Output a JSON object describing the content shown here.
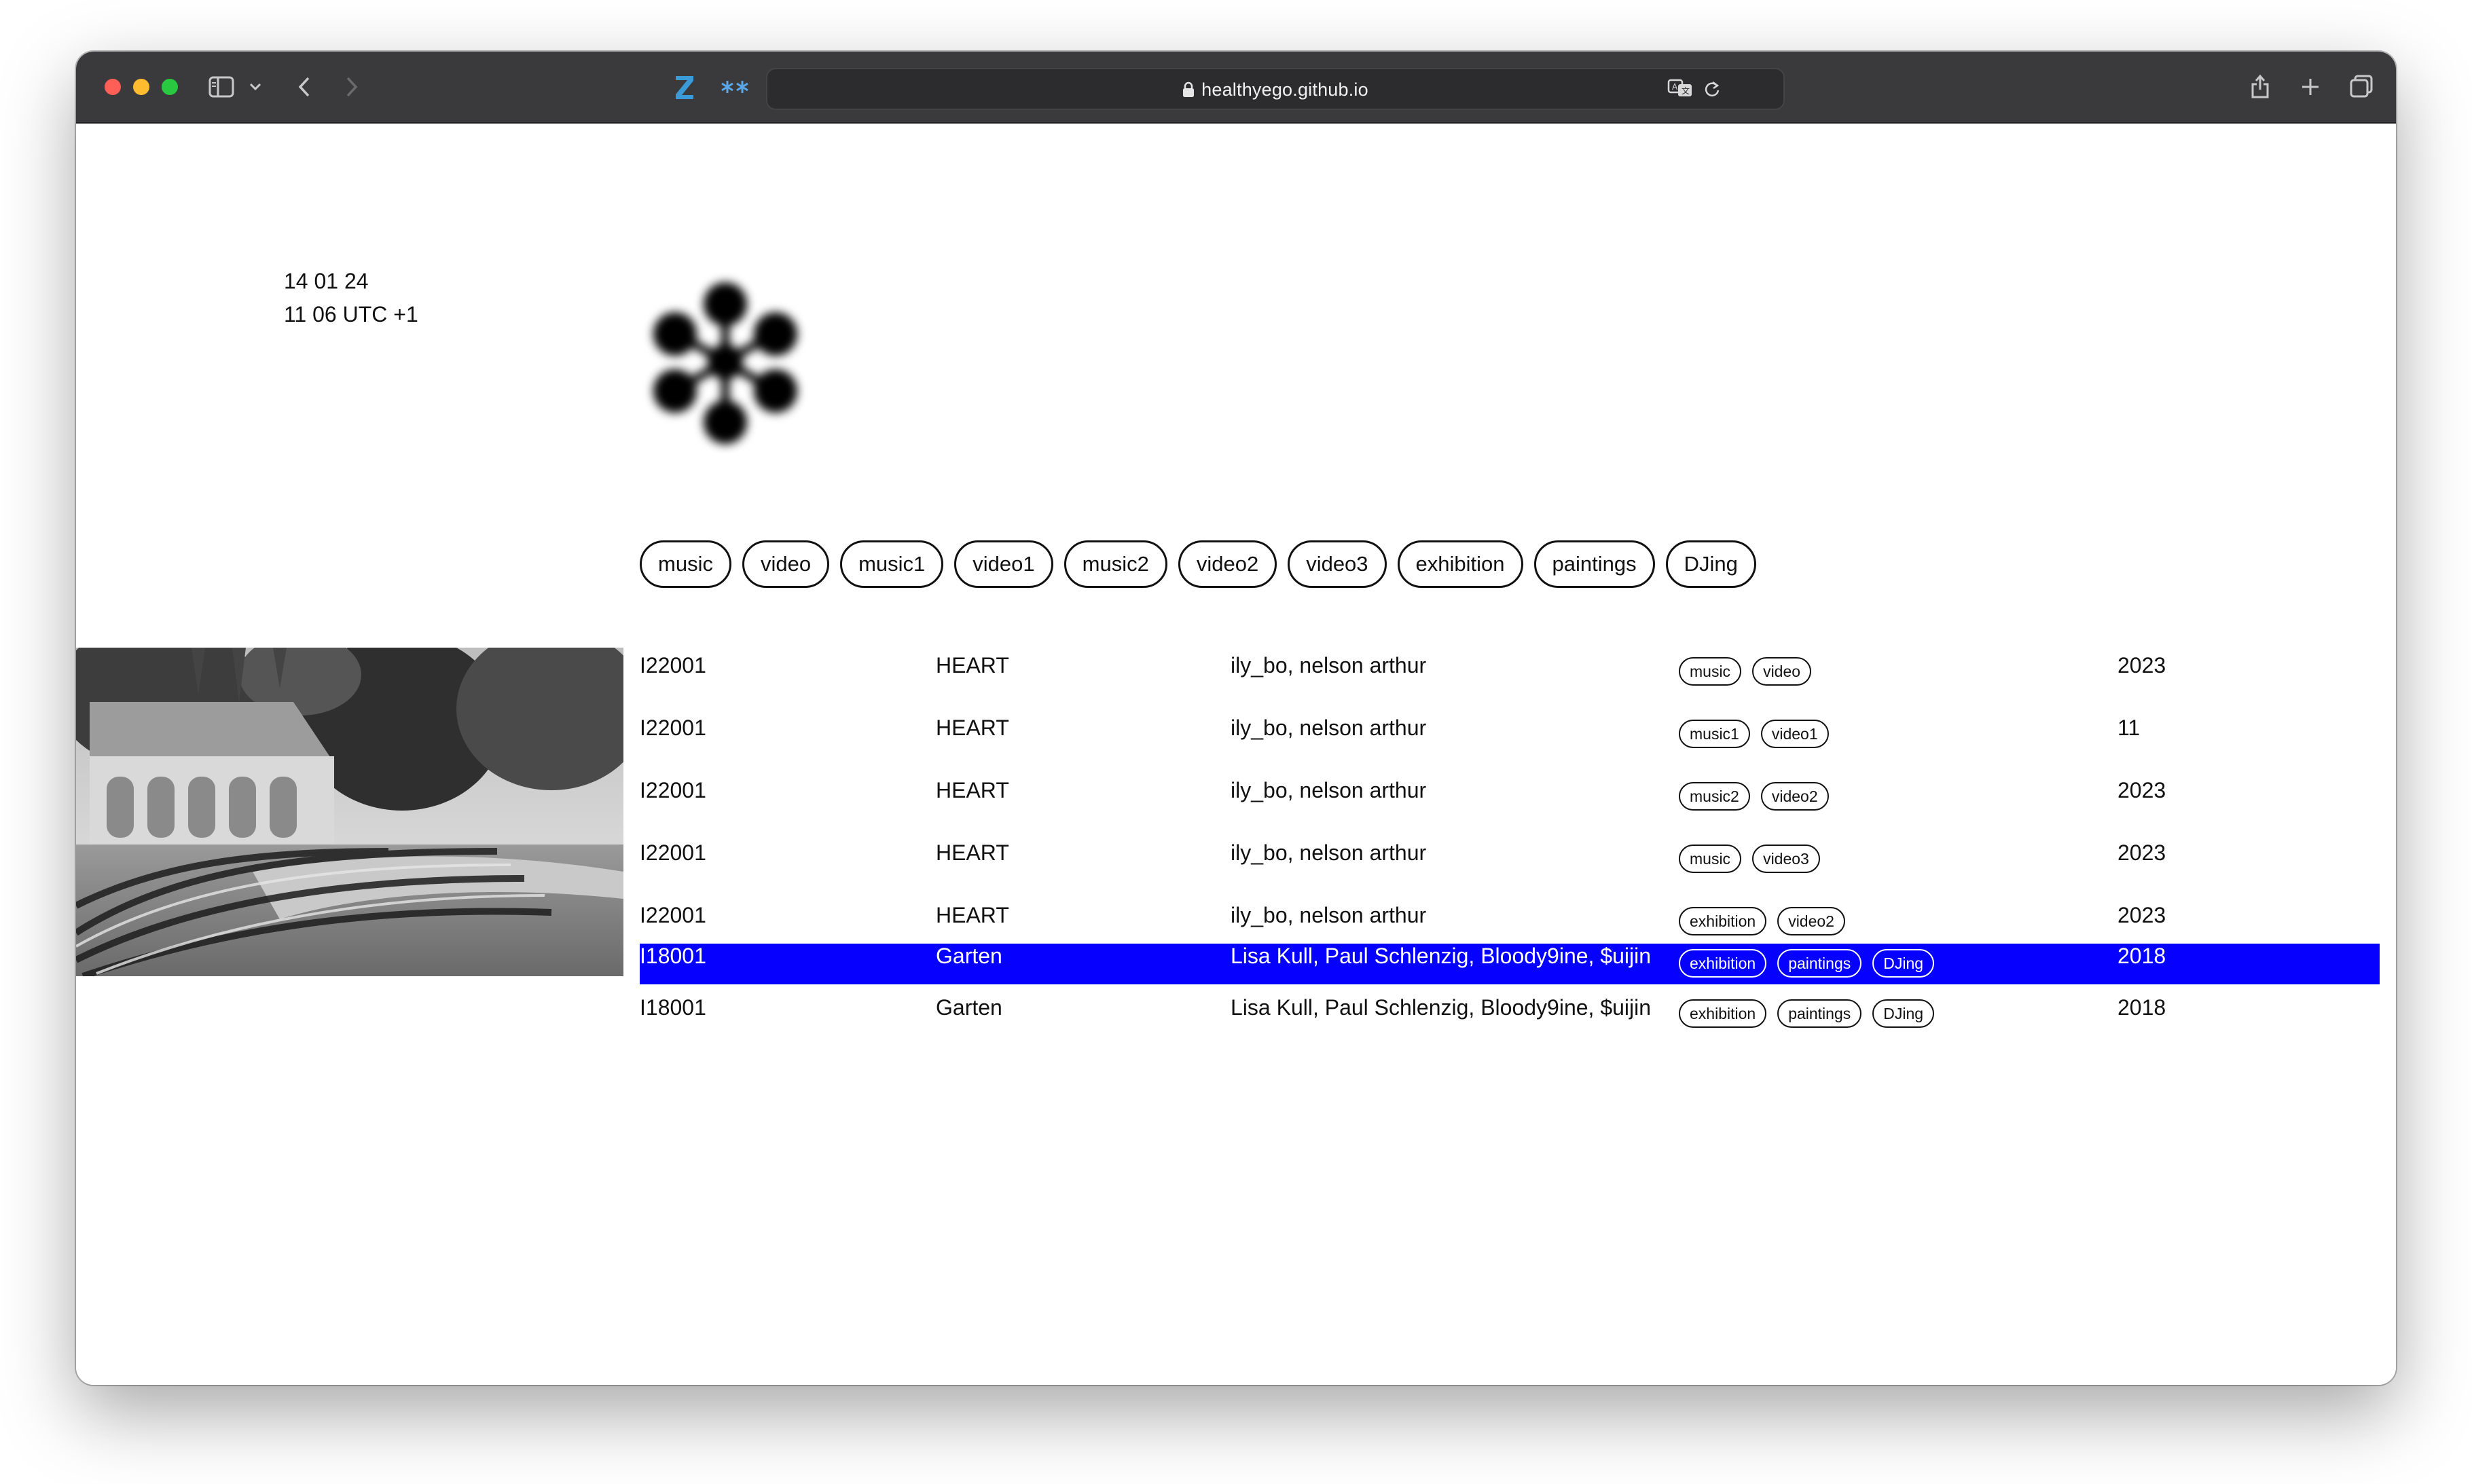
{
  "browser": {
    "url": "healthyego.github.io",
    "colors": {
      "close": "#ff5f57",
      "minimize": "#febc2e",
      "zoom": "#28c840",
      "toolbar": "#3a3a3c"
    },
    "icons": [
      "sidebar-icon",
      "chevron-down-icon",
      "back-icon",
      "forward-icon",
      "zotero-z-icon",
      "asterisk-extension-icon",
      "lock-icon",
      "translate-icon",
      "reload-icon",
      "share-icon",
      "new-tab-icon",
      "tab-overview-icon"
    ]
  },
  "header": {
    "date": "14 01 24",
    "time": "11 06 UTC +1"
  },
  "filters": [
    "music",
    "video",
    "music1",
    "video1",
    "music2",
    "video2",
    "video3",
    "exhibition",
    "paintings",
    "DJing"
  ],
  "rows": [
    {
      "id": "I22001",
      "title": "HEART",
      "artists": "ily_bo, nelson arthur",
      "tags": [
        "music",
        "video"
      ],
      "year": "2023",
      "highlighted": false
    },
    {
      "id": "I22001",
      "title": "HEART",
      "artists": "ily_bo, nelson arthur",
      "tags": [
        "music1",
        "video1"
      ],
      "year": "11",
      "highlighted": false
    },
    {
      "id": "I22001",
      "title": "HEART",
      "artists": "ily_bo, nelson arthur",
      "tags": [
        "music2",
        "video2"
      ],
      "year": "2023",
      "highlighted": false
    },
    {
      "id": "I22001",
      "title": "HEART",
      "artists": "ily_bo, nelson arthur",
      "tags": [
        "music",
        "video3"
      ],
      "year": "2023",
      "highlighted": false
    },
    {
      "id": "I22001",
      "title": "HEART",
      "artists": "ily_bo, nelson arthur",
      "tags": [
        "exhibition",
        "video2"
      ],
      "year": "2023",
      "highlighted": false
    },
    {
      "id": "I18001",
      "title": "Garten",
      "artists": "Lisa Kull, Paul Schlenzig, Bloody9ine, $uijin",
      "tags": [
        "exhibition",
        "paintings",
        "DJing"
      ],
      "year": "2018",
      "highlighted": true
    },
    {
      "id": "I18001",
      "title": "Garten",
      "artists": "Lisa Kull, Paul Schlenzig, Bloody9ine, $uijin",
      "tags": [
        "exhibition",
        "paintings",
        "DJing"
      ],
      "year": "2018",
      "highlighted": false
    }
  ],
  "highlight_color": "#0500ff"
}
